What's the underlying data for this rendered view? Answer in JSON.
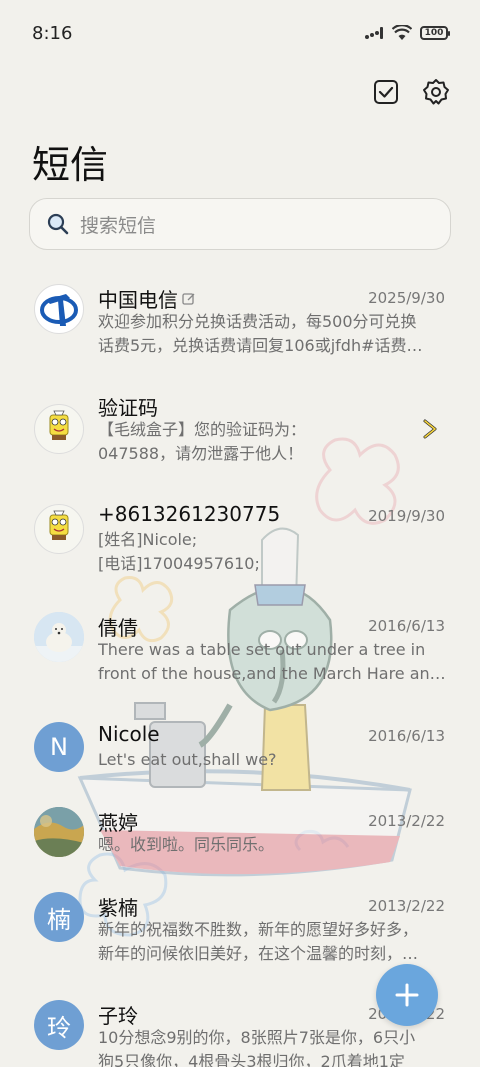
{
  "status": {
    "time": "8:16",
    "battery": "100",
    "icons": [
      "signal-icon",
      "wifi-icon",
      "battery-icon"
    ]
  },
  "header": {
    "title": "短信",
    "actions": [
      "select-icon",
      "gear-icon"
    ]
  },
  "search": {
    "placeholder": "搜索短信"
  },
  "conversations": [
    {
      "name": "中国电信",
      "date": "2025/9/30",
      "line1": "欢迎参加积分兑换话费活动，每500分可兑换",
      "line2": "话费5元，兑换话费请回复106或jfdh#话费…",
      "avatar": "china-telecom-logo",
      "verified_icon": "edit-badge-icon"
    },
    {
      "name": "验证码",
      "date": "",
      "line1": "【毛绒盒子】您的验证码为：",
      "line2": "047588，请勿泄露于他人！",
      "avatar": "spongebob-avatar",
      "trailing_icon": "chevron-right-icon"
    },
    {
      "name": "+8613261230775",
      "date": "2019/9/30",
      "line1": "[姓名]Nicole;",
      "line2": "[电话]17004957610;",
      "avatar": "spongebob-avatar"
    },
    {
      "name": "倩倩",
      "date": "2016/6/13",
      "line1": "There was a table set out under a tree in",
      "line2": "front of the house,and the March Hare an…",
      "avatar": "polar-bear-photo"
    },
    {
      "name": "Nicole",
      "date": "2016/6/13",
      "line1": "Let's eat out,shall we?",
      "line2": "",
      "avatar_letter": "N",
      "avatar_color": "#6f9fd3"
    },
    {
      "name": "燕婷",
      "date": "2013/2/22",
      "line1": "嗯。收到啦。同乐同乐。",
      "line2": "",
      "avatar": "landscape-photo"
    },
    {
      "name": "紫楠",
      "date": "2013/2/22",
      "line1": "新年的祝福数不胜数，新年的愿望好多好多，",
      "line2": "新年的问候依旧美好，在这个温馨的时刻，…",
      "avatar_letter": "楠",
      "avatar_color": "#6f9fd3"
    },
    {
      "name": "子玲",
      "date": "2013/2/22",
      "line1": "10分想念9别的你，8张照片7张是你，6只小",
      "line2": "狗5只像你，4根骨头3根归你，2爪着地1定",
      "avatar_letter": "玲",
      "avatar_color": "#6f9fd3"
    }
  ],
  "fab": {
    "icon": "plus-icon"
  },
  "colors": {
    "accent": "#6aa6dd",
    "background": "#f2f1ec"
  }
}
